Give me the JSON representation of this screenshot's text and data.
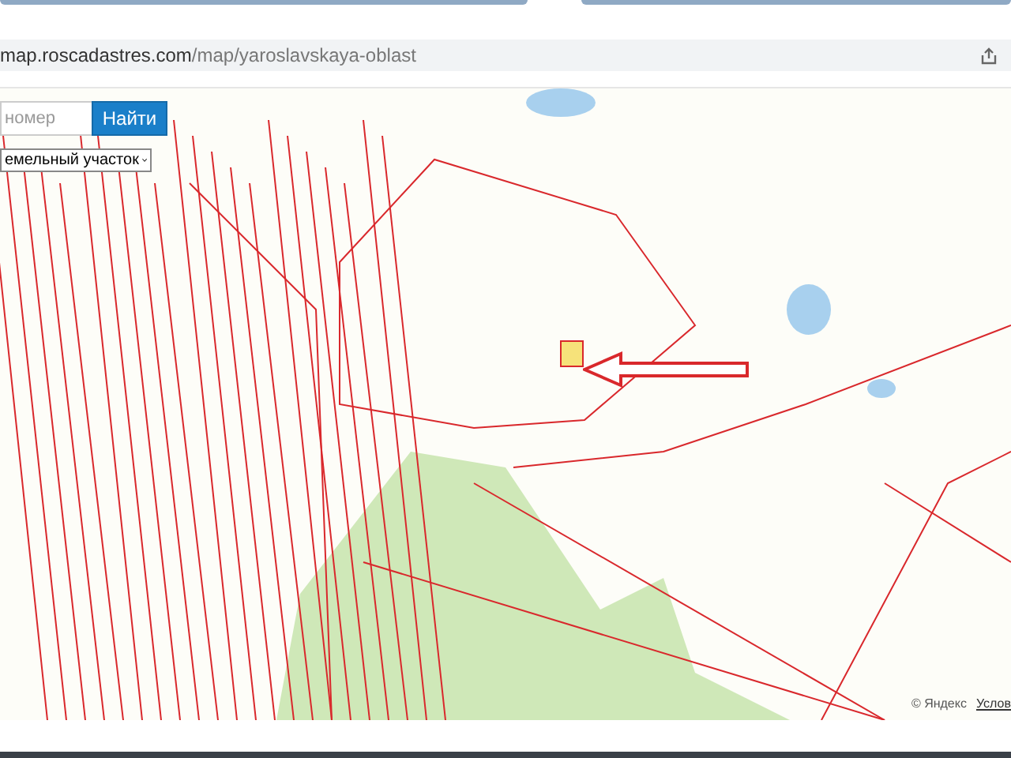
{
  "address_bar": {
    "url_host": "map.roscadastres.com",
    "url_path": "/map/yaroslavskaya-oblast"
  },
  "search": {
    "placeholder": "номер",
    "button": "Найти"
  },
  "object_type": {
    "value": "емельный участок"
  },
  "attribution": {
    "copyright": "© Яндекс",
    "terms_link": "Услов"
  }
}
